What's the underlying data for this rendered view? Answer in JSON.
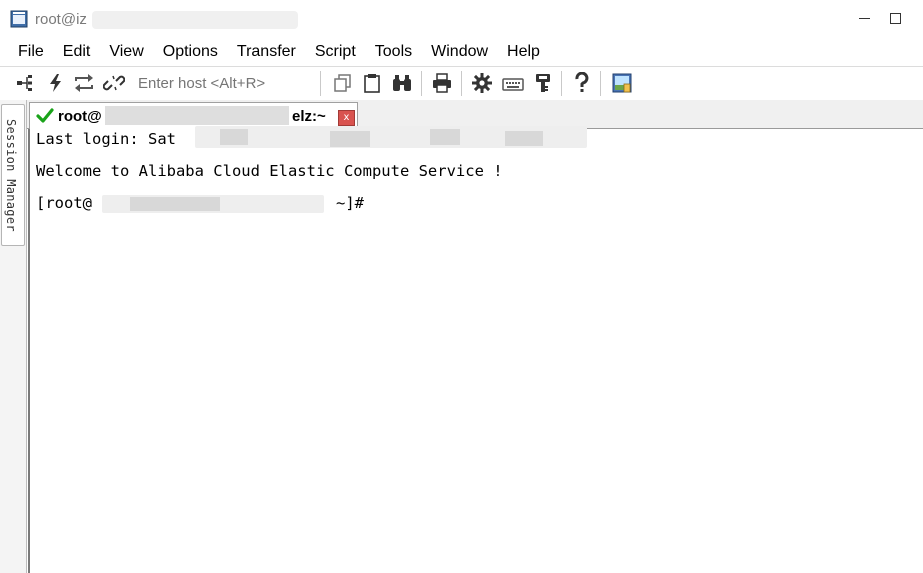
{
  "window": {
    "title": "root@iz",
    "app_icon": "securecrt-terminal-icon"
  },
  "menu": [
    "File",
    "Edit",
    "View",
    "Options",
    "Transfer",
    "Script",
    "Tools",
    "Window",
    "Help"
  ],
  "toolbar": {
    "host_placeholder": "Enter host <Alt+R>",
    "icons": [
      "connect-tree-icon",
      "quick-connect-lightning-icon",
      "reconnect-icon",
      "disconnect-icon",
      "copy-icon",
      "paste-icon",
      "find-binoculars-icon",
      "print-icon",
      "settings-gear-icon",
      "keymap-keyboard-icon",
      "key-agent-icon",
      "help-icon",
      "sftp-icon"
    ]
  },
  "session_manager": {
    "label": "Session Manager"
  },
  "tab": {
    "title_prefix": "root@",
    "title_suffix": "elz:~",
    "close_label": "x",
    "status_icon": "connected-check-icon"
  },
  "terminal": {
    "line1": "Last login: Sat",
    "line2": "Welcome to Alibaba Cloud Elastic Compute Service !",
    "line3_prefix": "[root@",
    "line3_suffix": "~]#"
  },
  "colors": {
    "check_green": "#1aa31a",
    "close_red": "#d9534f"
  }
}
